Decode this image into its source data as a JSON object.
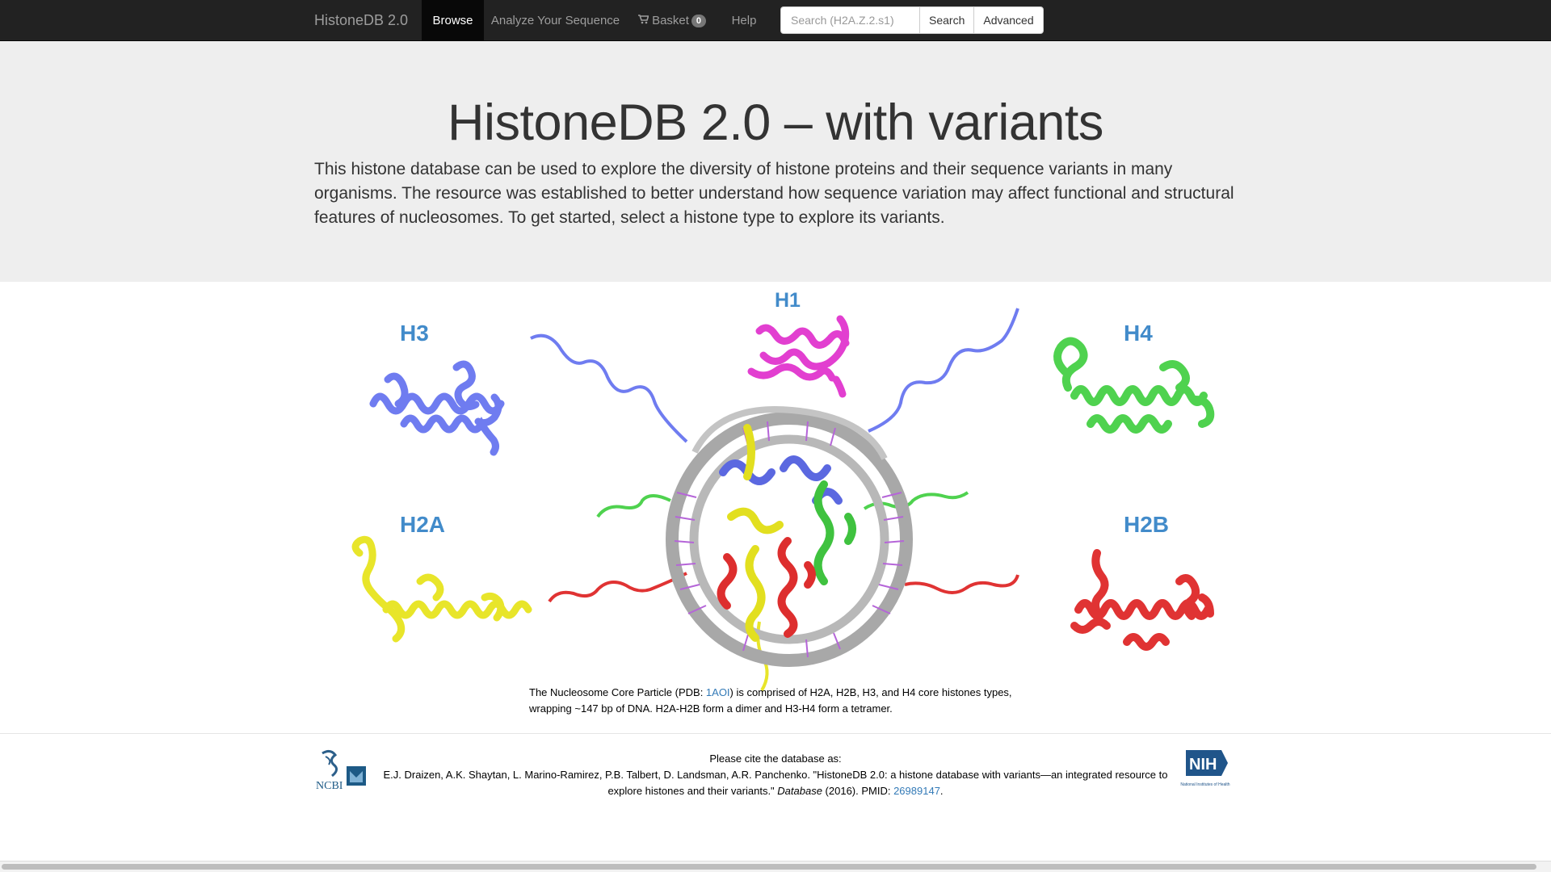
{
  "navbar": {
    "brand": "HistoneDB 2.0",
    "items": [
      {
        "label": "Browse",
        "active": true
      },
      {
        "label": "Analyze Your Sequence"
      },
      {
        "label": "Basket",
        "badge": "0"
      },
      {
        "label": "Help"
      }
    ],
    "search": {
      "placeholder": "Search (H2A.Z.2.s1)",
      "button": "Search",
      "advanced": "Advanced"
    }
  },
  "jumbotron": {
    "title": "HistoneDB 2.0 – with variants",
    "description": "This histone database can be used to explore the diversity of histone proteins and their sequence variants in many organisms. The resource was established to better understand how sequence variation may affect functional and structural features of nucleosomes. To get started, select a histone type to explore its variants."
  },
  "figure": {
    "labels": {
      "h1": "H1",
      "h3": "H3",
      "h4": "H4",
      "h2a": "H2A",
      "h2b": "H2B"
    },
    "colors": {
      "h3": "#6f7cf0",
      "h1": "#e23fd0",
      "h4": "#4fd24f",
      "h2a": "#e8e52a",
      "h2b": "#e03333",
      "dna": "#a8a8a8",
      "label": "#428bca"
    },
    "caption": {
      "before": "The Nucleosome Core Particle (PDB: ",
      "link": "1AOI",
      "after": ") is comprised of H2A, H2B, H3, and H4 core histones types, wrapping ~147 bp of DNA. H2A-H2B form a dimer and H3-H4 form a tetramer."
    }
  },
  "footer": {
    "cite_heading": "Please cite the database as:",
    "cite_text": "E.J. Draizen, A.K. Shaytan, L. Marino-Ramirez, P.B. Talbert, D. Landsman, A.R. Panchenko. \"HistoneDB 2.0: a histone database with variants—an integrated resource to explore histones and their variants.\" ",
    "cite_journal": "Database",
    "cite_year": " (2016). PMID: ",
    "pmid": "26989147",
    "cite_end": ".",
    "ncbi": "NCBI",
    "nih": "NIH",
    "nih_sub": "National Institutes of Health"
  }
}
